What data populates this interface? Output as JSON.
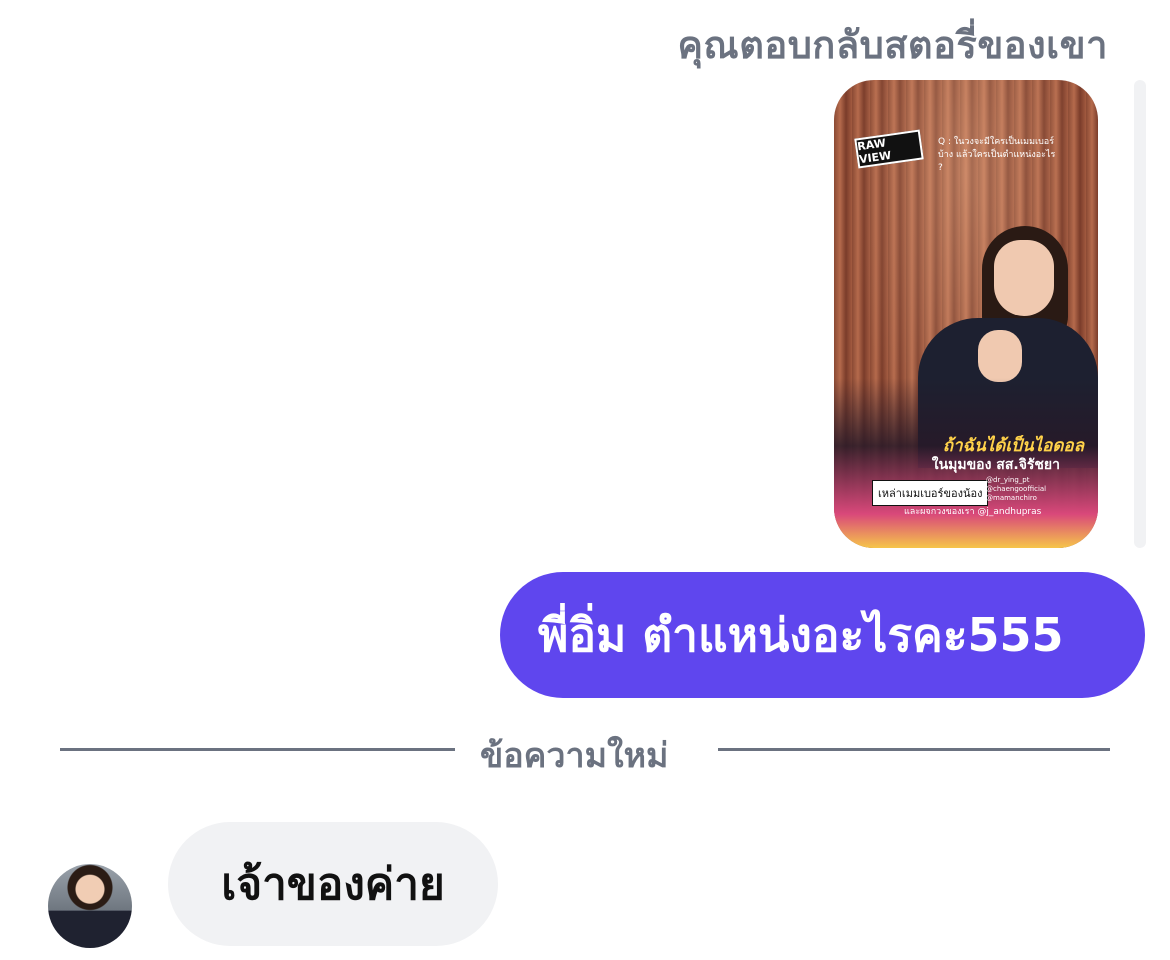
{
  "conversation": {
    "reply_caption": "คุณตอบกลับสตอรี่ของเขา",
    "story": {
      "logo_text": "RAW VIEW",
      "question_text": "Q : ในวงจะมีใครเป็นเมมเบอร์บ้าง แล้วใครเป็นตำแหน่งอะไร ?",
      "headline": "ถ้าฉันได้เป็นไอดอล",
      "subline": "ในมุมของ สส.จิรัชยา",
      "tag": "เหล่าเมมเบอร์ของน้อง",
      "handles": [
        "@dr_ying_pt",
        "@chaengoofficial",
        "@mamanchiro"
      ],
      "credit": "และผจกวงของเรา @j_andhupras"
    },
    "outgoing_message": "พี่อิ่ม ตำแหน่งอะไรคะ555",
    "new_messages_label": "ข้อความใหม่",
    "incoming_message": "เจ้าของค่าย"
  }
}
